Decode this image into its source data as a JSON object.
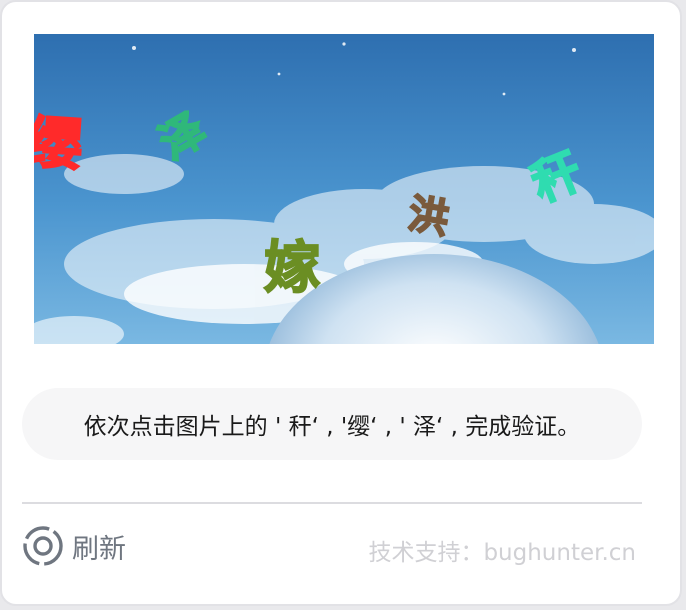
{
  "captcha": {
    "characters": [
      {
        "char": "缨",
        "color": "#ff2a2a"
      },
      {
        "char": "泽",
        "color": "#2fb87a"
      },
      {
        "char": "秆",
        "color": "#2fdcb0"
      },
      {
        "char": "洪",
        "color": "#7a5a3c"
      },
      {
        "char": "嫁",
        "color": "#6b8e23"
      }
    ],
    "hint": "依次点击图片上的 ' 秆‘ , '缨‘ , ' 泽‘ , 完成验证。"
  },
  "footer": {
    "refresh_label": "刷新",
    "support_text": "技术支持：bughunter.cn"
  },
  "colors": {
    "sky_top": "#2e6fb0",
    "sky_bottom": "#7ab8e2",
    "hint_background": "#f6f6f7",
    "refresh_icon": "#6f7680"
  }
}
